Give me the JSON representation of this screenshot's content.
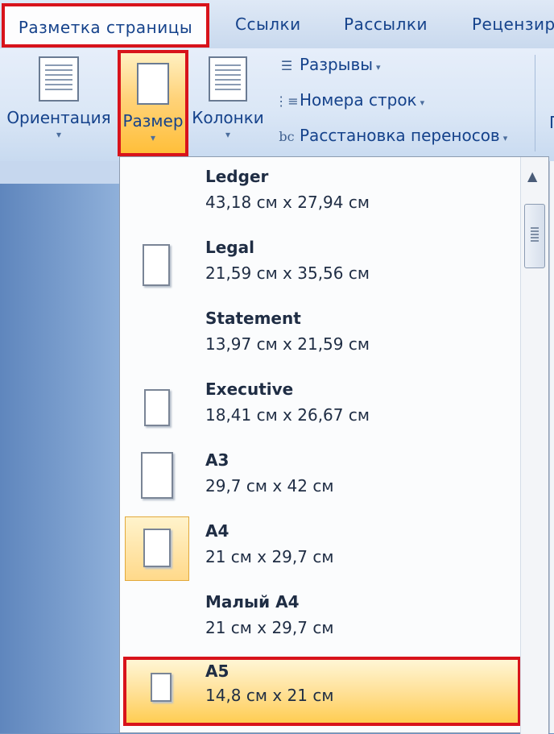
{
  "tabs": {
    "active": "Разметка страницы",
    "others": [
      "Ссылки",
      "Рассылки",
      "Рецензир"
    ]
  },
  "ribbon": {
    "orientation_label": "Ориентация",
    "size_label": "Размер",
    "columns_label": "Колонки",
    "breaks_label": "Разрывы",
    "line_numbers_label": "Номера строк",
    "hyphenation_label": "Расстановка переносов",
    "cut_label": "П"
  },
  "menu": {
    "items": [
      {
        "name": "Ledger",
        "size": "43,18 см х 27,94 см"
      },
      {
        "name": "Legal",
        "size": "21,59 см х 35,56 см"
      },
      {
        "name": "Statement",
        "size": "13,97 см х 21,59 см"
      },
      {
        "name": "Executive",
        "size": "18,41 см х 26,67 см"
      },
      {
        "name": "A3",
        "size": "29,7 см х 42 см"
      },
      {
        "name": "A4",
        "size": "21 см х 29,7 см"
      },
      {
        "name": "Малый A4",
        "size": "21 см х 29,7 см"
      },
      {
        "name": "A5",
        "size": "14,8 см х 21 см"
      }
    ]
  },
  "colors": {
    "highlight_border": "#d8131b",
    "accent_text": "#15428b",
    "selected_fill": "#ffd98a"
  }
}
